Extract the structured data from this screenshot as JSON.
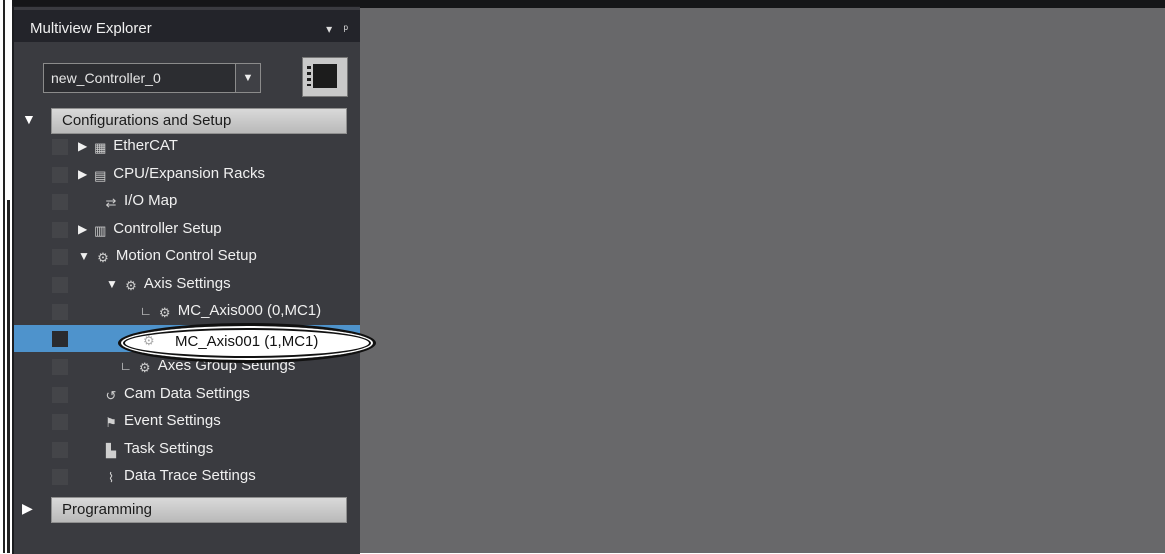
{
  "explorer": {
    "title": "Multiview Explorer",
    "pin_glyph": "▾ ᵖ",
    "controller": "new_Controller_0",
    "dropdown_glyph": "▼"
  },
  "sections": {
    "config": {
      "label": "Configurations and Setup",
      "expanded": true,
      "glyph": "▼"
    },
    "programming": {
      "label": "Programming",
      "expanded": false,
      "glyph": "▶"
    }
  },
  "tree": [
    {
      "label": "EtherCAT",
      "icon": "ethercat-icon",
      "glyph": "▦",
      "expander": "▶"
    },
    {
      "label": "CPU/Expansion Racks",
      "icon": "cpu-rack-icon",
      "glyph": "▤",
      "expander": "▶"
    },
    {
      "label": "I/O Map",
      "icon": "io-map-icon",
      "glyph": "⇄",
      "expander": ""
    },
    {
      "label": "Controller Setup",
      "icon": "controller-setup-icon",
      "glyph": "▥",
      "expander": "▶"
    },
    {
      "label": "Motion Control Setup",
      "icon": "motion-gear-icon",
      "glyph": "⚙",
      "expander": "▼"
    },
    {
      "label": "Axis Settings",
      "icon": "axis-gear-icon",
      "glyph": "⚙",
      "expander": "▼"
    },
    {
      "label": "MC_Axis000 (0,MC1)",
      "icon": "axis-item-icon",
      "glyph": "⚙",
      "expander": "∟"
    },
    {
      "label": "MC_Axis001 (1,MC1)",
      "icon": "axis-item-icon",
      "glyph": "⚙",
      "expander": "∟"
    },
    {
      "label": "Axes Group Settings",
      "icon": "axes-group-icon",
      "glyph": "⚙",
      "expander": "∟"
    },
    {
      "label": "Cam Data Settings",
      "icon": "cam-icon",
      "glyph": "↺",
      "expander": ""
    },
    {
      "label": "Event Settings",
      "icon": "event-flag-icon",
      "glyph": "⚑",
      "expander": ""
    },
    {
      "label": "Task Settings",
      "icon": "task-icon",
      "glyph": "▙",
      "expander": ""
    },
    {
      "label": "Data Trace Settings",
      "icon": "data-trace-icon",
      "glyph": "⌇",
      "expander": ""
    }
  ],
  "callout": {
    "label": "MC_Axis001 (1,MC1)",
    "glyph": "⚙",
    "expander": "∟"
  },
  "colors": {
    "panel_bg": "#3a3b40",
    "workspace_bg": "#68686a",
    "selection": "#4e93cc",
    "section_bar": "#c8c8c8"
  }
}
